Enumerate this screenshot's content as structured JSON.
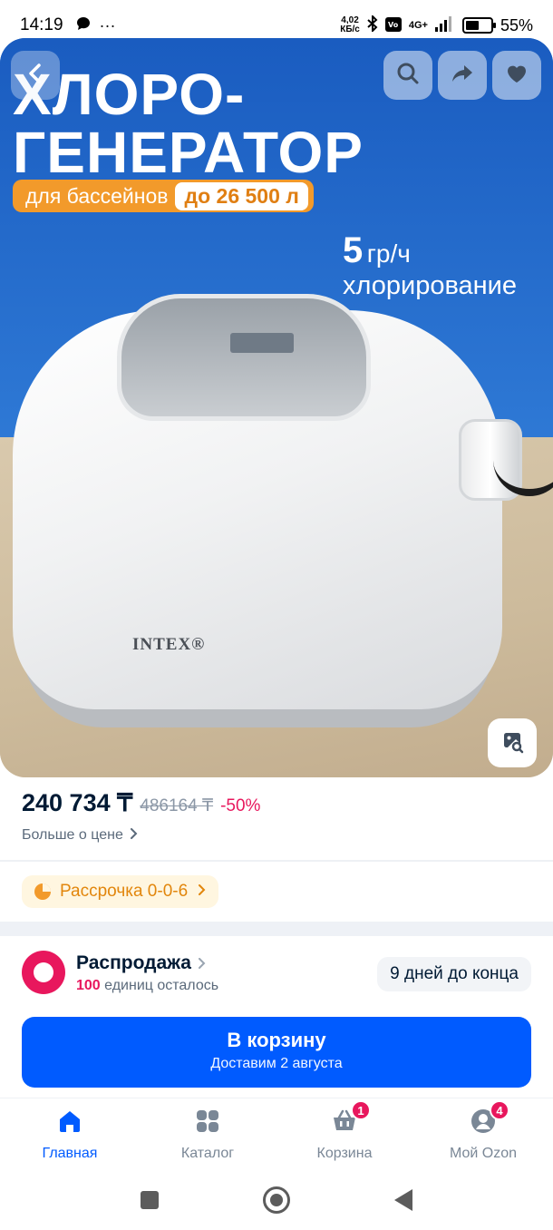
{
  "status_bar": {
    "time": "14:19",
    "speed_value": "4,02",
    "speed_unit": "КБ/с",
    "network": "4G+",
    "battery_level": 0.55,
    "battery": "55%"
  },
  "hero": {
    "title": "ХЛОРО-\nГЕНЕРАТОР",
    "badge_text": "для бассейнов",
    "badge_volume": "до 26 500 л",
    "rate_number": "5",
    "rate_unit": "гр/ч",
    "rate_text": "хлорирование",
    "brand": "INTEX®"
  },
  "price": {
    "current": "240 734 ₸",
    "old": "486164 ₸",
    "discount": "-50%",
    "more_link": "Больше о цене"
  },
  "installment": {
    "label": "Рассрочка 0-0-6"
  },
  "sale": {
    "title": "Распродажа",
    "units_count": "100",
    "units_text": "единиц осталось",
    "days_left": "9 дней до конца"
  },
  "cart_button": {
    "label": "В корзину",
    "delivery": "Доставим 2 августа"
  },
  "tabs": [
    {
      "label": "Главная",
      "icon": "home-icon",
      "active": true
    },
    {
      "label": "Каталог",
      "icon": "catalog-icon"
    },
    {
      "label": "Корзина",
      "icon": "cart-icon",
      "badge": "1"
    },
    {
      "label": "Мой Ozon",
      "icon": "profile-icon",
      "badge": "4"
    }
  ],
  "colors": {
    "accent": "#005bff",
    "discount": "#e8175d",
    "installment": "#e2860c"
  }
}
